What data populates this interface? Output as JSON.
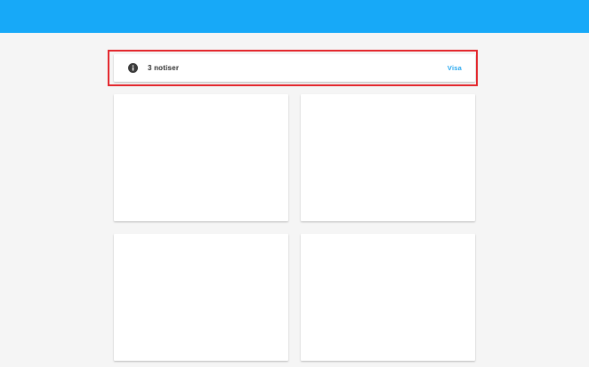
{
  "header": {
    "color": "#17a9f8"
  },
  "notice": {
    "icon": "info-icon",
    "text": "3 notiser",
    "action_label": "Visa",
    "accent_color": "#22a6ef",
    "highlight_color": "#e3262c"
  },
  "tiles": [
    {},
    {},
    {},
    {}
  ]
}
